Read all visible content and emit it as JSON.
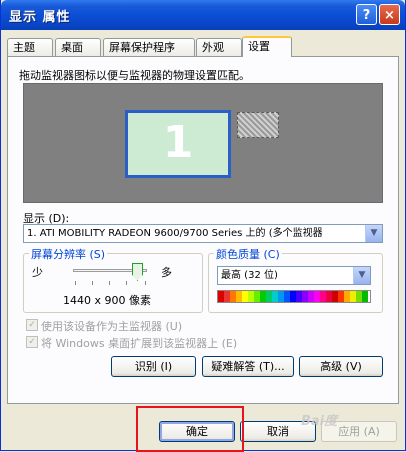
{
  "window": {
    "title": "显示 属性"
  },
  "titlebar": {
    "help_icon": "?",
    "close_icon": "×"
  },
  "tabs": [
    {
      "label": "主题"
    },
    {
      "label": "桌面"
    },
    {
      "label": "屏幕保护程序"
    },
    {
      "label": "外观"
    },
    {
      "label": "设置"
    }
  ],
  "settings": {
    "instruction": "拖动监视器图标以便与监视器的物理设置匹配。",
    "primary_monitor_number": "1",
    "display_label": "显示 (D):",
    "display_value": "1. ATI MOBILITY RADEON 9600/9700 Series 上的 (多个监视器",
    "resolution": {
      "title": "屏幕分辨率 (S)",
      "less": "少",
      "more": "多",
      "value": "1440 x 900 像素",
      "slider_level": 0.9
    },
    "color_quality": {
      "title": "颜色质量 (C)",
      "value": "最高 (32 位)"
    },
    "checkbox_primary": "使用该设备作为主监视器 (U)",
    "checkbox_extend": "将 Windows 桌面扩展到该监视器上 (E)",
    "identify_button": "识别 (I)",
    "troubleshoot_button": "疑难解答 (T)...",
    "advanced_button": "高级 (V)"
  },
  "footer": {
    "ok_button": "确定",
    "cancel_button": "取消",
    "apply_button": "应用 (A)"
  },
  "watermark": "Bai度"
}
